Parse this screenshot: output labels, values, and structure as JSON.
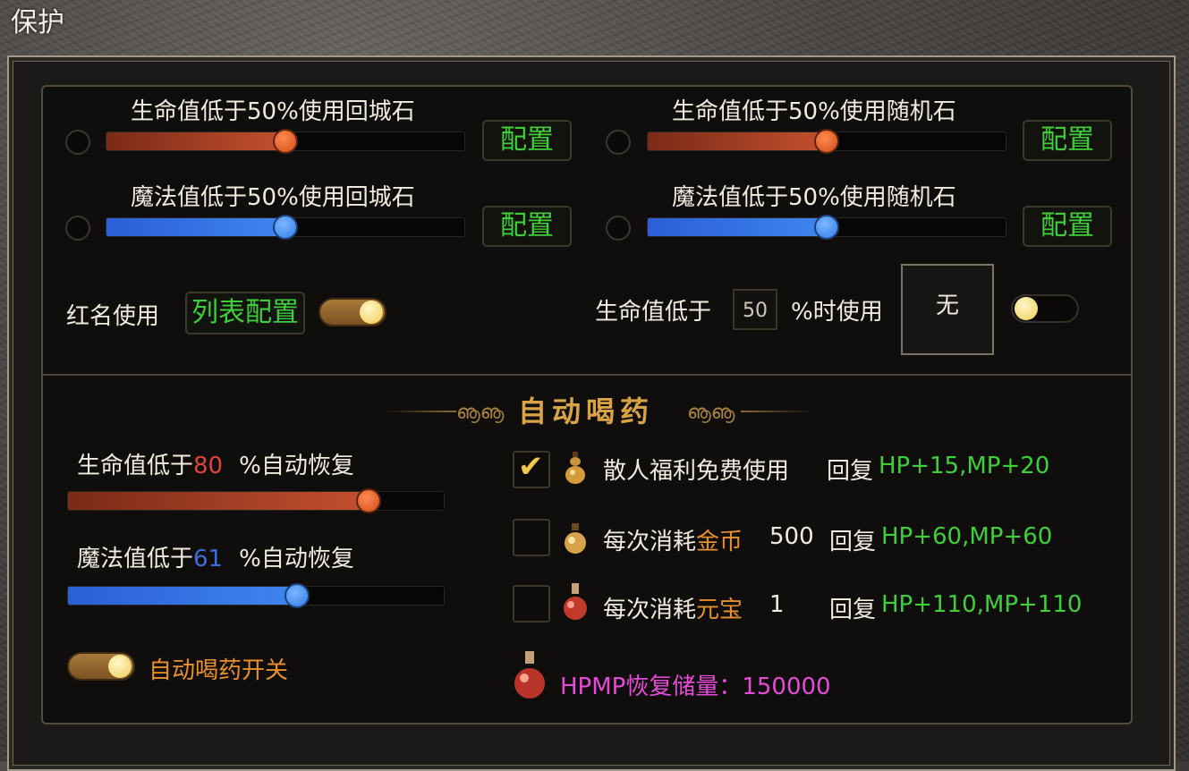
{
  "window": {
    "title": "保护"
  },
  "protect": {
    "rows": [
      {
        "label": "生命值低于50%使用回城石",
        "percent": 50,
        "color": "red",
        "button": "配置"
      },
      {
        "label": "生命值低于50%使用随机石",
        "percent": 50,
        "color": "red",
        "button": "配置"
      },
      {
        "label": "魔法值低于50%使用回城石",
        "percent": 50,
        "color": "blue",
        "button": "配置"
      },
      {
        "label": "魔法值低于50%使用随机石",
        "percent": 50,
        "color": "blue",
        "button": "配置"
      }
    ],
    "red_name": {
      "label": "红名使用",
      "button": "列表配置",
      "toggle_on": true
    },
    "hp_item": {
      "prefix": "生命值低于",
      "value": "50",
      "suffix": "%时使用",
      "item": "无",
      "toggle_on": false
    }
  },
  "auto_potion": {
    "title": "自动喝药",
    "hp": {
      "prefix": "生命值低于",
      "value": "80",
      "suffix": "%自动恢复",
      "percent": 80
    },
    "mp": {
      "prefix": "魔法值低于",
      "value": "61",
      "suffix": "%自动恢复",
      "percent": 61
    },
    "switch": {
      "label": "自动喝药开关",
      "on": true
    },
    "options": [
      {
        "checked": true,
        "text": "散人福利免费使用",
        "currency": "",
        "amount": "",
        "restore_label": "回复",
        "restore": "HP+15,MP+20",
        "icon": "gold-gourd-icon"
      },
      {
        "checked": false,
        "text": "每次消耗",
        "currency": "金币",
        "amount": "500",
        "restore_label": "回复",
        "restore": "HP+60,MP+60",
        "icon": "gold-flask-icon"
      },
      {
        "checked": false,
        "text": "每次消耗",
        "currency": "元宝",
        "amount": "1",
        "restore_label": "回复",
        "restore": "HP+110,MP+110",
        "icon": "red-flask-icon"
      }
    ],
    "reserve": {
      "text": "HPMP恢复储量：150000",
      "icon": "red-potion-icon"
    }
  },
  "colors": {
    "accent_green": "#3fcf39",
    "hp_red": "#c4502e",
    "mp_blue": "#3f86ee",
    "gold_title": "#d9a445",
    "reserve_pink": "#e64bd8",
    "currency_orange": "#e8902c"
  }
}
